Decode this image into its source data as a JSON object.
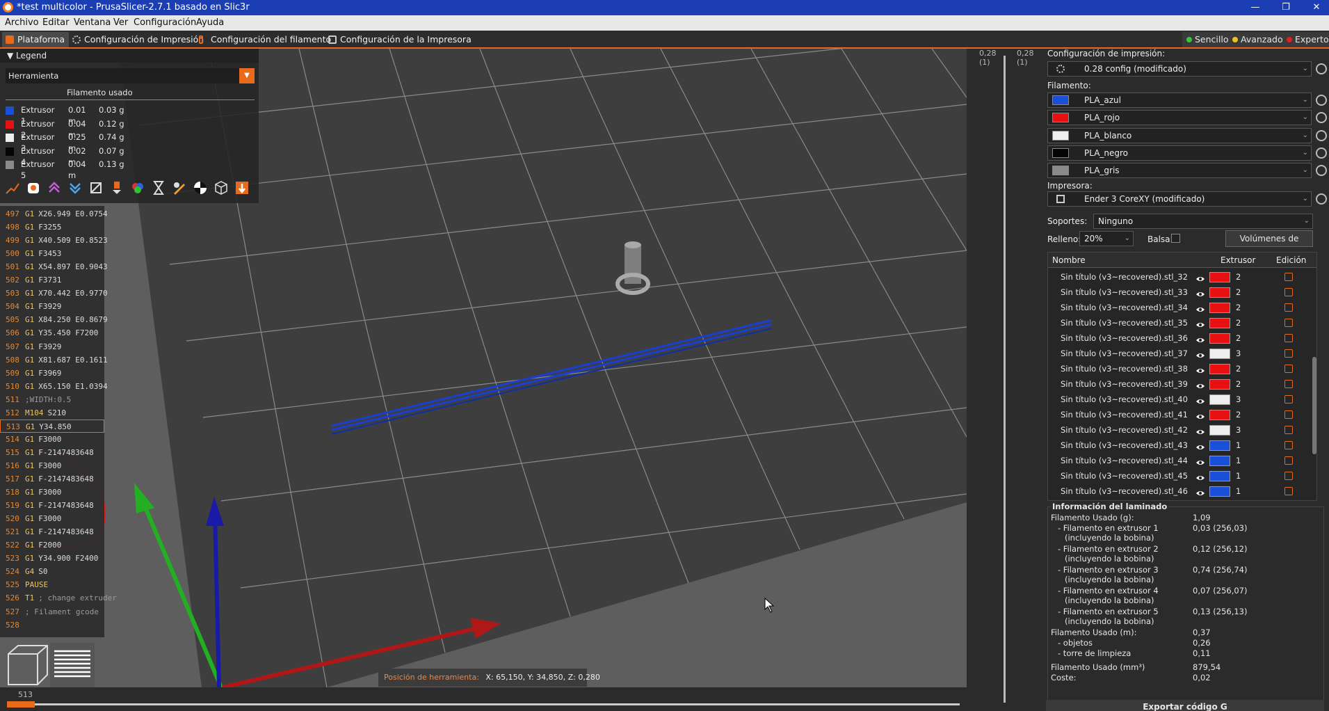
{
  "window": {
    "title": "*test multicolor - PrusaSlicer-2.7.1 basado en Slic3r",
    "min_icon": "minimize-icon",
    "max_icon": "maximize-icon",
    "close_icon": "close-icon"
  },
  "menu": [
    "Archivo",
    "Editar",
    "Ventana",
    "Ver",
    "Configuración",
    "Ayuda"
  ],
  "tabs": [
    "Plataforma",
    "Configuración de Impresión",
    "Configuración del filamento",
    "Configuración de la Impresora"
  ],
  "modes": [
    {
      "label": "Sencillo",
      "color": "#3cc43c"
    },
    {
      "label": "Avanzado",
      "color": "#f0c020"
    },
    {
      "label": "Experto",
      "color": "#e02020"
    }
  ],
  "legend": {
    "title": "Legend",
    "view_type": "Herramienta",
    "subtitle": "Filamento usado",
    "rows": [
      {
        "name": "Extrusor 1",
        "length": "0.01 m",
        "weight": "0.03 g",
        "color": "#1a4fd8"
      },
      {
        "name": "Extrusor 2",
        "length": "0.04 m",
        "weight": "0.12 g",
        "color": "#e81010"
      },
      {
        "name": "Extrusor 3",
        "length": "0.25 m",
        "weight": "0.74 g",
        "color": "#eeeeee"
      },
      {
        "name": "Extrusor 4",
        "length": "0.02 m",
        "weight": "0.07 g",
        "color": "#050505"
      },
      {
        "name": "Extrusor 5",
        "length": "0.04 m",
        "weight": "0.13 g",
        "color": "#8a8a8a"
      }
    ]
  },
  "gcode": [
    {
      "n": "497",
      "cmd": "G1",
      "arg": "X26.949 E0.0754"
    },
    {
      "n": "498",
      "cmd": "G1",
      "arg": "F3255"
    },
    {
      "n": "499",
      "cmd": "G1",
      "arg": "X40.509 E0.8523"
    },
    {
      "n": "500",
      "cmd": "G1",
      "arg": "F3453"
    },
    {
      "n": "501",
      "cmd": "G1",
      "arg": "X54.897 E0.9043"
    },
    {
      "n": "502",
      "cmd": "G1",
      "arg": "F3731"
    },
    {
      "n": "503",
      "cmd": "G1",
      "arg": "X70.442 E0.9770"
    },
    {
      "n": "504",
      "cmd": "G1",
      "arg": "F3929"
    },
    {
      "n": "505",
      "cmd": "G1",
      "arg": "X84.250 E0.8679"
    },
    {
      "n": "506",
      "cmd": "G1",
      "arg": "Y35.450 F7200"
    },
    {
      "n": "507",
      "cmd": "G1",
      "arg": "F3929"
    },
    {
      "n": "508",
      "cmd": "G1",
      "arg": "X81.687 E0.1611"
    },
    {
      "n": "509",
      "cmd": "G1",
      "arg": "F3969"
    },
    {
      "n": "510",
      "cmd": "G1",
      "arg": "X65.150 E1.0394"
    },
    {
      "n": "511",
      "cmd": "",
      "arg": ";WIDTH:0.5"
    },
    {
      "n": "512",
      "cmd": "M104",
      "arg": "S210"
    },
    {
      "n": "513",
      "cmd": "G1",
      "arg": "Y34.850"
    },
    {
      "n": "514",
      "cmd": "G1",
      "arg": "F3000"
    },
    {
      "n": "515",
      "cmd": "G1",
      "arg": "F-2147483648"
    },
    {
      "n": "516",
      "cmd": "G1",
      "arg": "F3000"
    },
    {
      "n": "517",
      "cmd": "G1",
      "arg": "F-2147483648"
    },
    {
      "n": "518",
      "cmd": "G1",
      "arg": "F3000"
    },
    {
      "n": "519",
      "cmd": "G1",
      "arg": "F-2147483648"
    },
    {
      "n": "520",
      "cmd": "G1",
      "arg": "F3000"
    },
    {
      "n": "521",
      "cmd": "G1",
      "arg": "F-2147483648"
    },
    {
      "n": "522",
      "cmd": "G1",
      "arg": "F2000"
    },
    {
      "n": "523",
      "cmd": "G1",
      "arg": "Y34.900 F2400"
    },
    {
      "n": "524",
      "cmd": "G4",
      "arg": "S0"
    },
    {
      "n": "525",
      "cmd": "PAUSE",
      "arg": ""
    },
    {
      "n": "526",
      "cmd": "T1",
      "arg": "; change extruder"
    },
    {
      "n": "527",
      "cmd": "",
      "arg": "; Filament gcode"
    },
    {
      "n": "528",
      "cmd": "",
      "arg": ""
    }
  ],
  "tool_position": {
    "label": "Posición de herramienta:",
    "value": "X: 65,150, Y: 34,850, Z: 0,280"
  },
  "hslider_value": "513",
  "vslider": {
    "top_left": "0,28",
    "top_left_sub": "(1)",
    "top_right": "0,28",
    "top_right_sub": "(1)"
  },
  "right": {
    "print_label": "Configuración de impresión:",
    "print_value": "0.28 config (modificado)",
    "filament_label": "Filamento:",
    "filaments": [
      {
        "name": "PLA_azul",
        "color": "#1a4fd8"
      },
      {
        "name": "PLA_rojo",
        "color": "#e81010"
      },
      {
        "name": "PLA_blanco",
        "color": "#eeeeee"
      },
      {
        "name": "PLA_negro",
        "color": "#050505"
      },
      {
        "name": "PLA_gris",
        "color": "#8a8a8a"
      }
    ],
    "printer_label": "Impresora:",
    "printer_value": "Ender 3 CoreXY (modificado)",
    "supports_label": "Soportes:",
    "supports_value": "Ninguno",
    "infill_label": "Relleno:",
    "infill_value": "20%",
    "brim_label": "Balsa:",
    "purge_button": "Volúmenes de purga..."
  },
  "objects": {
    "headers": {
      "name": "Nombre",
      "extruder": "Extrusor",
      "edit": "Edición"
    },
    "rows": [
      {
        "name": "Sin título (v3~recovered).stl_32",
        "ext": "2",
        "color": "#e81010"
      },
      {
        "name": "Sin título (v3~recovered).stl_33",
        "ext": "2",
        "color": "#e81010"
      },
      {
        "name": "Sin título (v3~recovered).stl_34",
        "ext": "2",
        "color": "#e81010"
      },
      {
        "name": "Sin título (v3~recovered).stl_35",
        "ext": "2",
        "color": "#e81010"
      },
      {
        "name": "Sin título (v3~recovered).stl_36",
        "ext": "2",
        "color": "#e81010"
      },
      {
        "name": "Sin título (v3~recovered).stl_37",
        "ext": "3",
        "color": "#eeeeee"
      },
      {
        "name": "Sin título (v3~recovered).stl_38",
        "ext": "2",
        "color": "#e81010"
      },
      {
        "name": "Sin título (v3~recovered).stl_39",
        "ext": "2",
        "color": "#e81010"
      },
      {
        "name": "Sin título (v3~recovered).stl_40",
        "ext": "3",
        "color": "#eeeeee"
      },
      {
        "name": "Sin título (v3~recovered).stl_41",
        "ext": "2",
        "color": "#e81010"
      },
      {
        "name": "Sin título (v3~recovered).stl_42",
        "ext": "3",
        "color": "#eeeeee"
      },
      {
        "name": "Sin título (v3~recovered).stl_43",
        "ext": "1",
        "color": "#1a4fd8"
      },
      {
        "name": "Sin título (v3~recovered).stl_44",
        "ext": "1",
        "color": "#1a4fd8"
      },
      {
        "name": "Sin título (v3~recovered).stl_45",
        "ext": "1",
        "color": "#1a4fd8"
      },
      {
        "name": "Sin título (v3~recovered).stl_46",
        "ext": "1",
        "color": "#1a4fd8"
      }
    ]
  },
  "info": {
    "title": "Información del laminado",
    "rows": [
      {
        "label": "Filamento Usado (g):",
        "sub": "",
        "value": "1,09"
      },
      {
        "label": "- Filamento en extrusor 1",
        "sub": "(incluyendo la bobina)",
        "value": "0,03 (256,03)"
      },
      {
        "label": "- Filamento en extrusor 2",
        "sub": "(incluyendo la bobina)",
        "value": "0,12 (256,12)"
      },
      {
        "label": "- Filamento en extrusor 3",
        "sub": "(incluyendo la bobina)",
        "value": "0,74 (256,74)"
      },
      {
        "label": "- Filamento en extrusor 4",
        "sub": "(incluyendo la bobina)",
        "value": "0,07 (256,07)"
      },
      {
        "label": "- Filamento en extrusor 5",
        "sub": "(incluyendo la bobina)",
        "value": "0,13 (256,13)"
      },
      {
        "label": "Filamento Usado (m):",
        "sub": "",
        "value": "0,37"
      },
      {
        "label": "- objetos",
        "sub": "",
        "value": "0,26"
      },
      {
        "label": "- torre de limpieza",
        "sub": "",
        "value": "0,11"
      },
      {
        "label": "Filamento Usado (mm³)",
        "sub": "",
        "value": "879,54"
      },
      {
        "label": "Coste:",
        "sub": "",
        "value": "0,02"
      }
    ]
  },
  "export_button": "Exportar código G"
}
